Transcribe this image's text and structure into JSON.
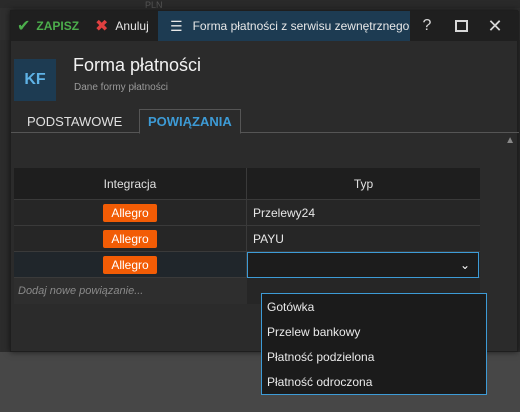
{
  "background": {
    "top_text": "PLN"
  },
  "toolbar": {
    "save_label": "ZAPISZ",
    "cancel_label": "Anuluj",
    "window_title": "Forma płatności z serwisu zewnętrznego",
    "help_label": "?",
    "close_label": "✕"
  },
  "header": {
    "avatar_initials": "KF",
    "title": "Forma płatności",
    "subtitle": "Dane formy płatności"
  },
  "tabs": [
    {
      "label": "PODSTAWOWE",
      "active": false
    },
    {
      "label": "POWIĄZANIA",
      "active": true
    }
  ],
  "grid": {
    "columns": [
      "Integracja",
      "Typ"
    ],
    "rows": [
      {
        "integration": "Allegro",
        "type": "Przelewy24"
      },
      {
        "integration": "Allegro",
        "type": "PAYU"
      },
      {
        "integration": "Allegro",
        "type": ""
      }
    ],
    "new_row_placeholder": "Dodaj nowe powiązanie..."
  },
  "dropdown": {
    "options": [
      "Gotówka",
      "Przelew bankowy",
      "Płatność podzielona",
      "Płatność odroczona"
    ]
  },
  "colors": {
    "accent": "#3d9bd6",
    "badge": "#f25c05",
    "save": "#4cae4c",
    "cancel": "#e04040",
    "title_bar": "#1d3b52"
  }
}
